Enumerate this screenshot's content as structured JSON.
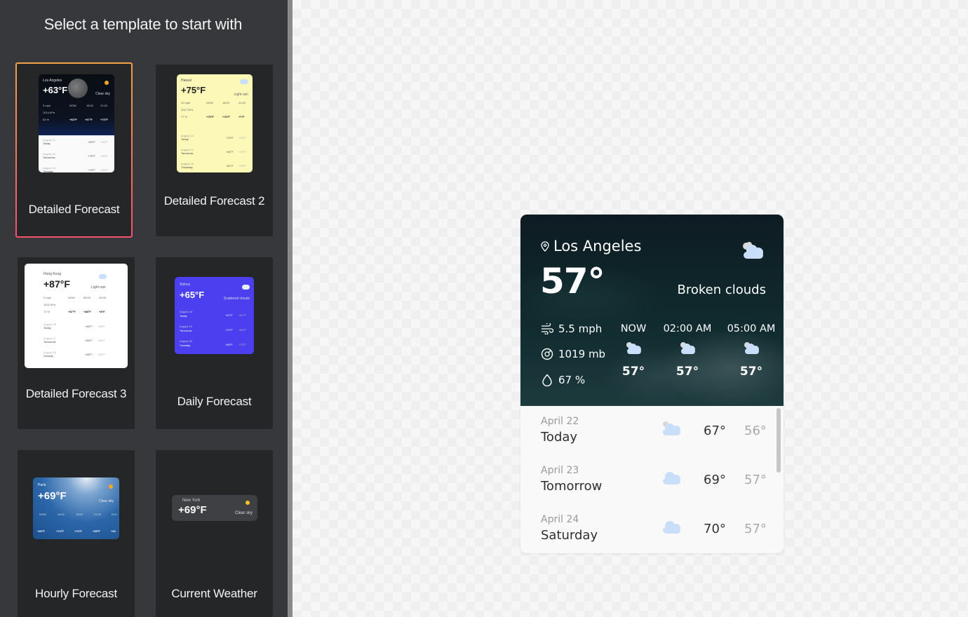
{
  "panel": {
    "title": "Select a template to start with",
    "templates": [
      {
        "label": "Detailed Forecast",
        "selected": true,
        "preview": {
          "city": "Los Angeles",
          "temp": "+63°F",
          "condition": "Clear sky",
          "stats": [
            "3 mph",
            "1014 hPa",
            "83 %"
          ],
          "hours": [
            {
              "time": "NOW",
              "temp": "+63°F"
            },
            {
              "time": "18:00",
              "temp": "+67°F"
            },
            {
              "time": "21:00",
              "temp": "+73°F"
            }
          ],
          "days": [
            {
              "date": "August 11",
              "day": "Today",
              "hi": "+63°F",
              "lo": "+63°F"
            },
            {
              "date": "August 12",
              "day": "Tomorrow",
              "hi": "+75°F",
              "lo": "+63°F"
            },
            {
              "date": "August 13",
              "day": "Tuesday",
              "hi": "+79°F",
              "lo": "+69°F"
            }
          ]
        }
      },
      {
        "label": "Detailed Forecast 2",
        "selected": false,
        "preview": {
          "city": "Hawaii",
          "temp": "+75°F",
          "condition": "Light rain",
          "stats": [
            "10 mph",
            "1017 hPa",
            "77 %"
          ],
          "hours": [
            {
              "time": "NOW",
              "temp": "+75°F"
            },
            {
              "time": "18:00",
              "temp": "+76°F"
            },
            {
              "time": "21:00",
              "temp": "+7°F"
            }
          ],
          "days": [
            {
              "date": "August 13",
              "day": "Today",
              "hi": "+75°F",
              "lo": "+75°F"
            },
            {
              "date": "August 14",
              "day": "Tomorrow",
              "hi": "+81°F",
              "lo": "+75°F"
            },
            {
              "date": "August 15",
              "day": "Thursday",
              "hi": "+81°F",
              "lo": "+78°F"
            }
          ]
        }
      },
      {
        "label": "Detailed Forecast 3",
        "selected": false,
        "preview": {
          "city": "Hong Kong",
          "temp": "+87°F",
          "condition": "Light rain",
          "stats": [
            "3 mph",
            "1002 hPa",
            "72 %"
          ],
          "hours": [
            {
              "time": "NOW",
              "temp": "+87°F"
            },
            {
              "time": "06:00",
              "temp": "+88°F"
            },
            {
              "time": "09:00",
              "temp": "+8°F"
            }
          ],
          "days": [
            {
              "date": "August 16",
              "day": "Today",
              "hi": "+89°F",
              "lo": "+85°F"
            },
            {
              "date": "August 17",
              "day": "Tomorrow",
              "hi": "+88°F",
              "lo": "+84°F"
            },
            {
              "date": "August 18",
              "day": "Sunday",
              "hi": "+88°F",
              "lo": "+83°F"
            }
          ]
        }
      },
      {
        "label": "Daily Forecast",
        "selected": false,
        "preview": {
          "city": "Sidney",
          "temp": "+65°F",
          "condition": "Scattered clouds",
          "days": [
            {
              "date": "August 18",
              "day": "Today",
              "hi": "+67°F",
              "lo": "+67°F"
            },
            {
              "date": "August 19",
              "day": "Tomorrow",
              "hi": "+71°F",
              "lo": "+66°F"
            },
            {
              "date": "August 20",
              "day": "Tuesday",
              "hi": "+84°F",
              "lo": "+72°F"
            }
          ]
        }
      },
      {
        "label": "Hourly Forecast",
        "selected": false,
        "preview": {
          "city": "Paris",
          "temp": "+69°F",
          "condition": "Clear sky",
          "hours": [
            {
              "time": "NOW",
              "temp": "+69°F"
            },
            {
              "time": "15:00",
              "temp": "+74°F"
            },
            {
              "time": "18:00",
              "temp": "+74°F"
            },
            {
              "time": "21:00",
              "temp": "+69°F"
            },
            {
              "time": "00:0",
              "temp": "+63"
            }
          ]
        }
      },
      {
        "label": "Current Weather",
        "selected": false,
        "preview": {
          "city": "New York",
          "temp": "+69°F",
          "condition": "Clear sky"
        }
      }
    ]
  },
  "widget": {
    "city": "Los Angeles",
    "temp": "57°",
    "condition": "Broken clouds",
    "main_icon": "broken-clouds-icon",
    "stats": {
      "wind": {
        "icon": "wind-icon",
        "value": "5.5 mph"
      },
      "pressure": {
        "icon": "pressure-gauge-icon",
        "value": "1019 mb"
      },
      "humidity": {
        "icon": "droplet-icon",
        "value": "67 %"
      }
    },
    "hourly": [
      {
        "label": "NOW",
        "temp": "57°",
        "icon": "broken-clouds-icon"
      },
      {
        "label": "02:00 AM",
        "temp": "57°",
        "icon": "broken-clouds-icon"
      },
      {
        "label": "05:00 AM",
        "temp": "57°",
        "icon": "broken-clouds-icon"
      }
    ],
    "daily": [
      {
        "date": "April 22",
        "day": "Today",
        "hi": "67°",
        "lo": "56°",
        "icon": "broken-clouds-icon"
      },
      {
        "date": "April 23",
        "day": "Tomorrow",
        "hi": "69°",
        "lo": "57°",
        "icon": "cloud-icon"
      },
      {
        "date": "April 24",
        "day": "Saturday",
        "hi": "70°",
        "lo": "57°",
        "icon": "cloud-icon"
      }
    ]
  },
  "colors": {
    "panel_bg": "#37383b",
    "card_bg": "#252628",
    "selected_border_top": "#f3a14a",
    "selected_border_bottom": "#f3506f",
    "cloud": "#c9def9"
  }
}
